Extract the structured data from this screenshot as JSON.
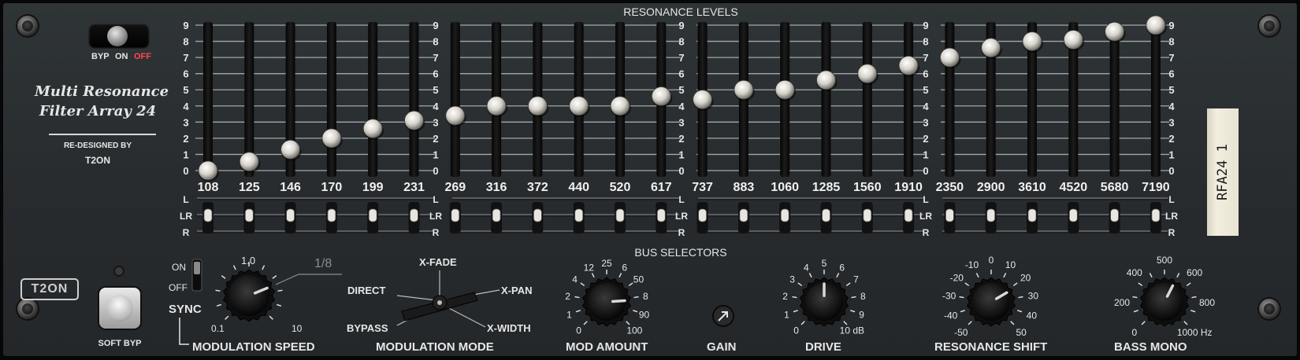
{
  "header": {
    "resonance_levels": "RESONANCE LEVELS",
    "bus_selectors": "BUS SELECTORS"
  },
  "brand": {
    "title_line1": "Multi Resonance",
    "title_line2": "Filter Array 24",
    "redesigned_by": "RE-DESIGNED BY",
    "author": "T2ON",
    "badge": "T2ON",
    "tape_label": "RFA24 1"
  },
  "bypass": {
    "byp_label": "BYP",
    "on_label": "ON",
    "off_label": "OFF",
    "state": "off",
    "soft_byp_label": "SOFT BYP"
  },
  "scale_levels": [
    "0",
    "1",
    "2",
    "3",
    "4",
    "5",
    "6",
    "7",
    "8",
    "9"
  ],
  "bus_labels": [
    "L",
    "LR",
    "R"
  ],
  "bands": [
    {
      "freq": "108",
      "level": 0.0,
      "bus": "LR"
    },
    {
      "freq": "125",
      "level": 0.55,
      "bus": "LR"
    },
    {
      "freq": "146",
      "level": 1.3,
      "bus": "LR"
    },
    {
      "freq": "170",
      "level": 2.0,
      "bus": "LR"
    },
    {
      "freq": "199",
      "level": 2.6,
      "bus": "LR"
    },
    {
      "freq": "231",
      "level": 3.1,
      "bus": "LR"
    },
    {
      "freq": "269",
      "level": 3.4,
      "bus": "LR"
    },
    {
      "freq": "316",
      "level": 4.0,
      "bus": "LR"
    },
    {
      "freq": "372",
      "level": 4.0,
      "bus": "LR"
    },
    {
      "freq": "440",
      "level": 4.0,
      "bus": "LR"
    },
    {
      "freq": "520",
      "level": 4.0,
      "bus": "LR"
    },
    {
      "freq": "617",
      "level": 4.6,
      "bus": "LR"
    },
    {
      "freq": "737",
      "level": 4.4,
      "bus": "LR"
    },
    {
      "freq": "883",
      "level": 5.0,
      "bus": "LR"
    },
    {
      "freq": "1060",
      "level": 5.0,
      "bus": "LR"
    },
    {
      "freq": "1285",
      "level": 5.6,
      "bus": "LR"
    },
    {
      "freq": "1560",
      "level": 6.0,
      "bus": "LR"
    },
    {
      "freq": "1910",
      "level": 6.5,
      "bus": "LR"
    },
    {
      "freq": "2350",
      "level": 7.0,
      "bus": "LR"
    },
    {
      "freq": "2900",
      "level": 7.6,
      "bus": "LR"
    },
    {
      "freq": "3610",
      "level": 8.0,
      "bus": "LR"
    },
    {
      "freq": "4520",
      "level": 8.1,
      "bus": "LR"
    },
    {
      "freq": "5680",
      "level": 8.6,
      "bus": "LR"
    },
    {
      "freq": "7190",
      "level": 9.0,
      "bus": "LR"
    }
  ],
  "sync": {
    "on_label": "ON",
    "off_label": "OFF",
    "label": "SYNC",
    "state": "on"
  },
  "mod_speed": {
    "label": "MODULATION SPEED",
    "tick_low": "0.1",
    "tick_mid": "1.0",
    "tick_high": "10",
    "sync_value": "1/8",
    "value": 0.75
  },
  "mod_mode": {
    "label": "MODULATION MODE",
    "options": [
      "DIRECT",
      "X-FADE",
      "X-PAN",
      "BYPASS",
      "X-WIDTH"
    ],
    "selected": "X-PAN"
  },
  "mod_amount": {
    "label": "MOD AMOUNT",
    "ticks": [
      "0",
      "1",
      "2",
      "4",
      "12",
      "25",
      "6",
      "50",
      "8",
      "90",
      "100"
    ],
    "value": 0.82
  },
  "gain": {
    "label": "GAIN"
  },
  "drive": {
    "label": "DRIVE",
    "ticks": [
      "0",
      "1",
      "2",
      "3",
      "4",
      "5",
      "6",
      "7",
      "8",
      "9",
      "10 dB"
    ],
    "value": 0.5
  },
  "resonance_shift": {
    "label": "RESONANCE SHIFT",
    "ticks": [
      "-50",
      "-40",
      "-30",
      "-20",
      "-10",
      "0",
      "10",
      "20",
      "30",
      "40",
      "50"
    ],
    "value": 0.72
  },
  "bass_mono": {
    "label": "BASS MONO",
    "ticks": [
      "0",
      "200",
      "400",
      "500",
      "600",
      "800",
      "1000 Hz"
    ],
    "value": 0.6
  },
  "colors": {
    "panel": "#2b3033",
    "text": "#e6e6e6",
    "off_red": "#ff4a4a",
    "tape": "#ece7d6"
  }
}
